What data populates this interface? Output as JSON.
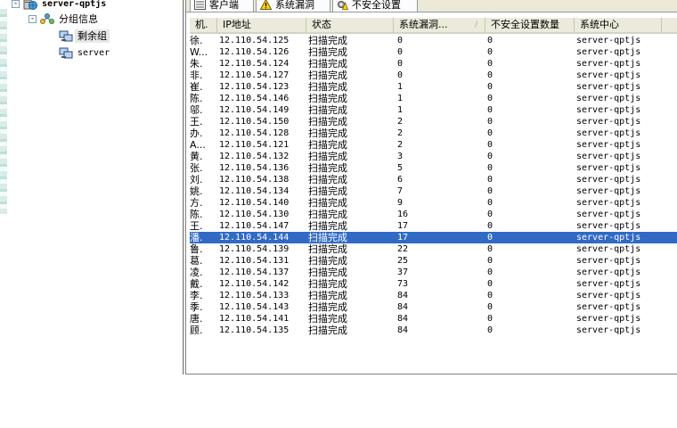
{
  "tree": {
    "root": {
      "label": "server-qptjs",
      "expander": "-"
    },
    "group": {
      "label": "分组信息",
      "expander": "-"
    },
    "items": [
      {
        "label": "剩余组",
        "selected": true
      },
      {
        "label": "server",
        "selected": false
      }
    ]
  },
  "tabs": [
    {
      "label": "客户端",
      "icon": "list-icon"
    },
    {
      "label": "系统漏洞",
      "icon": "warning-icon"
    },
    {
      "label": "不安全设置",
      "icon": "settings-warning-icon"
    }
  ],
  "table": {
    "columns": [
      "机.",
      "IP地址",
      "状态",
      "系统漏洞...",
      "不安全设置数量",
      "系统中心"
    ],
    "sort_indicator": "/",
    "selected_row": 17,
    "selection_color": "#316ac5",
    "rows": [
      [
        "徐.",
        "12.110.54.125",
        "扫描完成",
        "0",
        "0",
        "server-qptjs"
      ],
      [
        "W...",
        "12.110.54.126",
        "扫描完成",
        "0",
        "0",
        "server-qptjs"
      ],
      [
        "朱.",
        "12.110.54.124",
        "扫描完成",
        "0",
        "0",
        "server-qptjs"
      ],
      [
        "非.",
        "12.110.54.127",
        "扫描完成",
        "0",
        "0",
        "server-qptjs"
      ],
      [
        "崔.",
        "12.110.54.123",
        "扫描完成",
        "1",
        "0",
        "server-qptjs"
      ],
      [
        "陈.",
        "12.110.54.146",
        "扫描完成",
        "1",
        "0",
        "server-qptjs"
      ],
      [
        "邬.",
        "12.110.54.149",
        "扫描完成",
        "1",
        "0",
        "server-qptjs"
      ],
      [
        "王.",
        "12.110.54.150",
        "扫描完成",
        "2",
        "0",
        "server-qptjs"
      ],
      [
        "办.",
        "12.110.54.128",
        "扫描完成",
        "2",
        "0",
        "server-qptjs"
      ],
      [
        "A...",
        "12.110.54.121",
        "扫描完成",
        "2",
        "0",
        "server-qptjs"
      ],
      [
        "黄.",
        "12.110.54.132",
        "扫描完成",
        "3",
        "0",
        "server-qptjs"
      ],
      [
        "张.",
        "12.110.54.136",
        "扫描完成",
        "5",
        "0",
        "server-qptjs"
      ],
      [
        "刘.",
        "12.110.54.138",
        "扫描完成",
        "6",
        "0",
        "server-qptjs"
      ],
      [
        "姚.",
        "12.110.54.134",
        "扫描完成",
        "7",
        "0",
        "server-qptjs"
      ],
      [
        "方.",
        "12.110.54.140",
        "扫描完成",
        "9",
        "0",
        "server-qptjs"
      ],
      [
        "陈.",
        "12.110.54.130",
        "扫描完成",
        "16",
        "0",
        "server-qptjs"
      ],
      [
        "王.",
        "12.110.54.147",
        "扫描完成",
        "17",
        "0",
        "server-qptjs"
      ],
      [
        "潘.",
        "12.110.54.144",
        "扫描完成",
        "17",
        "0",
        "server-qptjs"
      ],
      [
        "鲁.",
        "12.110.54.139",
        "扫描完成",
        "22",
        "0",
        "server-qptjs"
      ],
      [
        "葛.",
        "12.110.54.131",
        "扫描完成",
        "25",
        "0",
        "server-qptjs"
      ],
      [
        "凌.",
        "12.110.54.137",
        "扫描完成",
        "37",
        "0",
        "server-qptjs"
      ],
      [
        "戴.",
        "12.110.54.142",
        "扫描完成",
        "73",
        "0",
        "server-qptjs"
      ],
      [
        "李.",
        "12.110.54.133",
        "扫描完成",
        "84",
        "0",
        "server-qptjs"
      ],
      [
        "季.",
        "12.110.54.143",
        "扫描完成",
        "84",
        "0",
        "server-qptjs"
      ],
      [
        "唐.",
        "12.110.54.141",
        "扫描完成",
        "84",
        "0",
        "server-qptjs"
      ],
      [
        "顾.",
        "12.110.54.135",
        "扫描完成",
        "84",
        "0",
        "server-qptjs"
      ]
    ]
  }
}
